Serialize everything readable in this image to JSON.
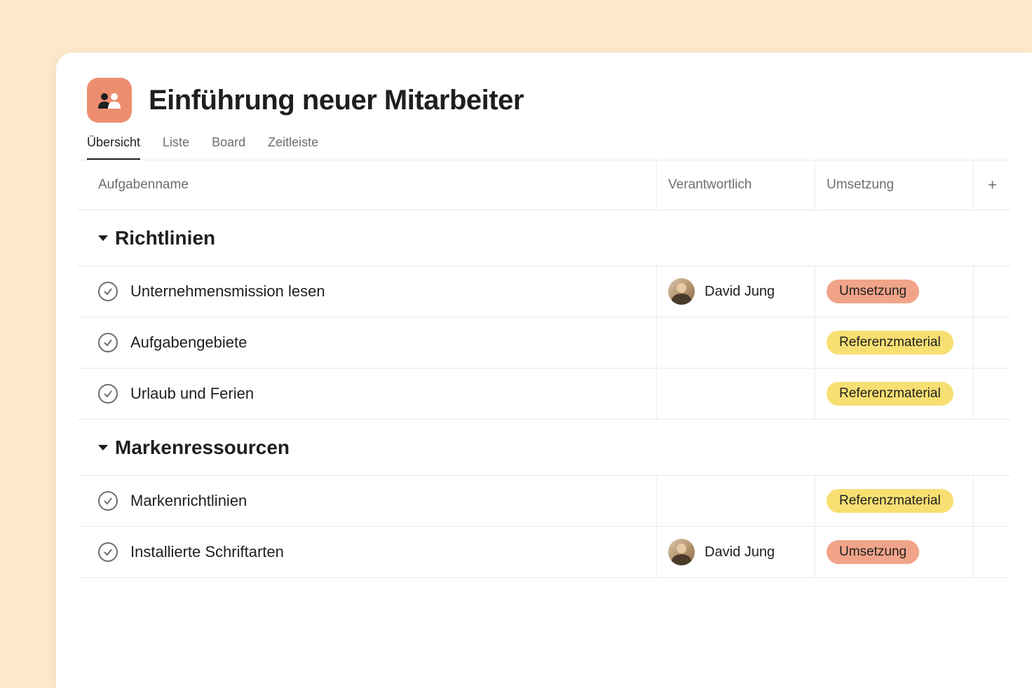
{
  "project": {
    "title": "Einführung neuer Mitarbeiter"
  },
  "tabs": [
    {
      "label": "Übersicht",
      "active": true
    },
    {
      "label": "Liste",
      "active": false
    },
    {
      "label": "Board",
      "active": false
    },
    {
      "label": "Zeitleiste",
      "active": false
    }
  ],
  "columns": {
    "name": "Aufgabenname",
    "assignee": "Verantwortlich",
    "tag": "Umsetzung"
  },
  "tags": {
    "umsetzung": {
      "label": "Umsetzung",
      "color": "orange"
    },
    "referenz": {
      "label": "Referenzmaterial",
      "color": "yellow"
    }
  },
  "sections": [
    {
      "title": "Richtlinien",
      "tasks": [
        {
          "name": "Unternehmensmission lesen",
          "assignee": "David Jung",
          "tag": "umsetzung"
        },
        {
          "name": "Aufgabengebiete",
          "assignee": null,
          "tag": "referenz"
        },
        {
          "name": "Urlaub und Ferien",
          "assignee": null,
          "tag": "referenz"
        }
      ]
    },
    {
      "title": "Markenressourcen",
      "tasks": [
        {
          "name": "Markenrichtlinien",
          "assignee": null,
          "tag": "referenz"
        },
        {
          "name": "Installierte Schriftarten",
          "assignee": "David Jung",
          "tag": "umsetzung"
        }
      ]
    }
  ]
}
